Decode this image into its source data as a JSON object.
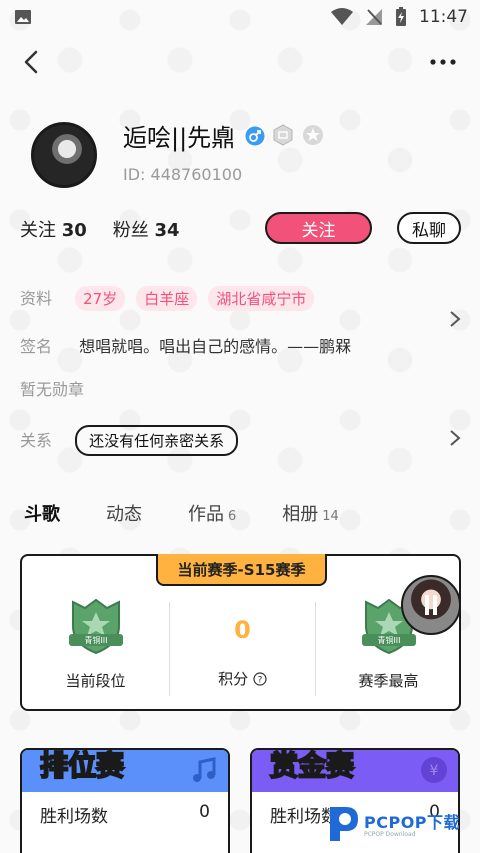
{
  "status_bar": {
    "time": "11:47"
  },
  "profile": {
    "nickname": "逅哙||先鼑",
    "user_id": "ID: 448760100",
    "following_label": "关注",
    "following_count": "30",
    "fans_label": "粉丝",
    "fans_count": "34",
    "follow_button": "关注",
    "message_button": "私聊"
  },
  "details": {
    "profile_label": "资料",
    "tags": [
      "27岁",
      "白羊座",
      "湖北省咸宁市"
    ],
    "signature_label": "签名",
    "signature": "想唱就唱。唱出自己的感情。——鹏槑",
    "medals_text": "暂无勋章",
    "relation_label": "关系",
    "relation_value": "还没有任何亲密关系"
  },
  "tabs": [
    {
      "label": "斗歌",
      "count": ""
    },
    {
      "label": "动态",
      "count": ""
    },
    {
      "label": "作品",
      "count": "6"
    },
    {
      "label": "相册",
      "count": "14"
    }
  ],
  "season": {
    "banner": "当前赛季-S15赛季",
    "current_rank_label": "当前段位",
    "current_rank_badge": "青铜III",
    "points_value": "0",
    "points_label": "积分",
    "best_rank_label": "赛季最高",
    "best_rank_badge": "青铜III"
  },
  "modes": [
    {
      "title": "排位赛",
      "row_label": "胜利场数",
      "row_value": "0",
      "color": "#5b8ff9"
    },
    {
      "title": "赏金赛",
      "row_label": "胜利场数",
      "row_value": "0",
      "color": "#7b5cf5"
    }
  ],
  "watermark": {
    "text": "PCPOP下载",
    "sub": "PCPOP Download"
  },
  "colors": {
    "accent": "#f2527a",
    "season_banner": "#ffb23f",
    "rank_green": "#5aa36b"
  }
}
